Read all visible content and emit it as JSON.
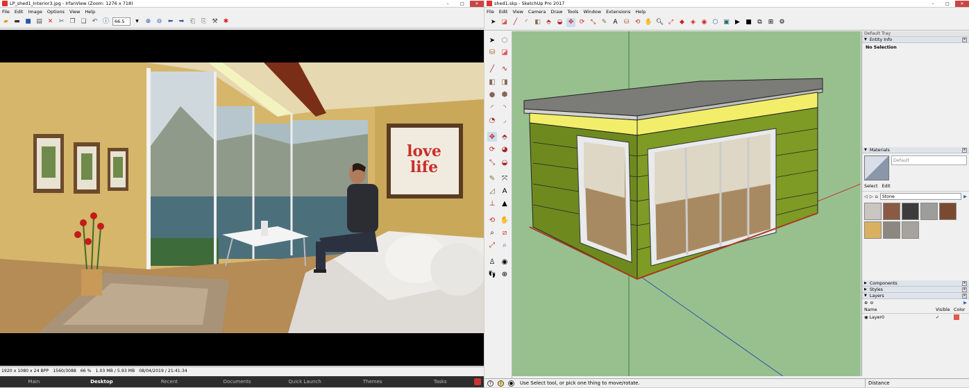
{
  "irfan": {
    "title": "LP_shed1_Interior3.jpg - IrfanView (Zoom: 1276 x 718)",
    "menu": [
      "File",
      "Edit",
      "Image",
      "Options",
      "View",
      "Help"
    ],
    "zoom_value": "66.5",
    "status": {
      "dims": "1920 x 1080 x 24 BPP",
      "index": "1560/3088",
      "zoom": "66 %",
      "size": "1.03 MB / 5.93 MB",
      "datetime": "08/04/2019 / 21:41:34"
    },
    "artwork": {
      "line1": "love",
      "line2": "life"
    }
  },
  "taskbar": {
    "items": [
      "Main",
      "Desktop",
      "Recent",
      "Documents",
      "Quick Launch",
      "Themes",
      "Tasks"
    ]
  },
  "sketchup": {
    "title": "shed1.skp - SketchUp Pro 2017",
    "menu": [
      "File",
      "Edit",
      "View",
      "Camera",
      "Draw",
      "Tools",
      "Window",
      "Extensions",
      "Help"
    ],
    "tray": {
      "title": "Default Tray",
      "entity_info": {
        "header": "Entity Info",
        "selection": "No Selection"
      },
      "materials": {
        "header": "Materials",
        "current": "Default",
        "tabs": [
          "Select",
          "Edit"
        ],
        "library": "Stone",
        "swatch_colors": [
          "#c9c6c2",
          "#8a5a44",
          "#3c3c3c",
          "#9d9d9b",
          "#7a4a30",
          "#d8b060",
          "#8d8781",
          "#a7a29d"
        ]
      },
      "components": "Components",
      "styles": "Styles",
      "layers": {
        "header": "Layers",
        "columns": [
          "Name",
          "Visible",
          "Color"
        ],
        "rows": [
          {
            "name": "Layer0",
            "visible": "✓",
            "color": "#e05a4a"
          }
        ]
      }
    },
    "status": {
      "hint": "Use Select tool, or pick one thing to move/rotate.",
      "measure_label": "Distance"
    }
  }
}
